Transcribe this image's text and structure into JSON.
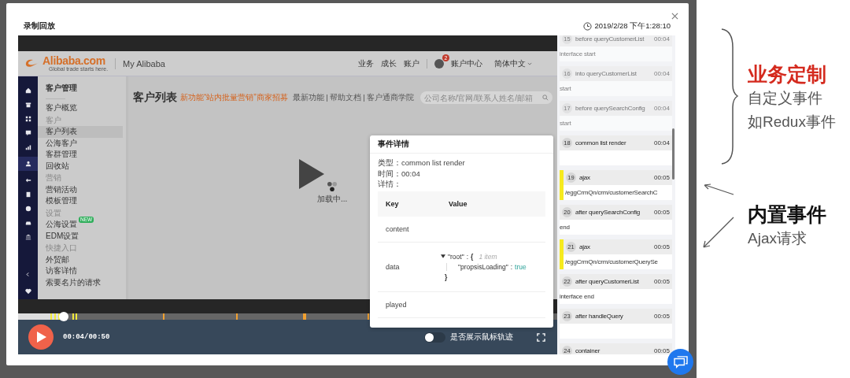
{
  "dialog": {
    "title": "录制回放",
    "timestamp": "2019/2/28 下午1:28:10"
  },
  "page": {
    "logo": "Alibaba.com",
    "logo_tagline": "Global trade starts here.",
    "site_name": "My Alibaba",
    "nav": [
      "业务",
      "成长",
      "账户"
    ],
    "notification_count": "2",
    "account": "账户中心",
    "language": "简体中文"
  },
  "sidebar": {
    "title": "客户管理",
    "items": [
      {
        "kind": "item",
        "label": "客户概览",
        "selected": false
      },
      {
        "kind": "group",
        "label": "客户"
      },
      {
        "kind": "item",
        "label": "客户列表",
        "selected": true
      },
      {
        "kind": "item",
        "label": "公海客户",
        "selected": false
      },
      {
        "kind": "item",
        "label": "客群管理",
        "selected": false
      },
      {
        "kind": "item",
        "label": "回收站",
        "selected": false
      },
      {
        "kind": "group",
        "label": "营销"
      },
      {
        "kind": "item",
        "label": "营销活动",
        "selected": false
      },
      {
        "kind": "item",
        "label": "模板管理",
        "selected": false
      },
      {
        "kind": "group",
        "label": "设置"
      },
      {
        "kind": "item",
        "label": "公海设置",
        "selected": false,
        "badge": "NEW"
      },
      {
        "kind": "item",
        "label": "EDM设置",
        "selected": false
      },
      {
        "kind": "group",
        "label": "快捷入口"
      },
      {
        "kind": "item",
        "label": "外贸邮",
        "selected": false
      },
      {
        "kind": "item",
        "label": "访客详情",
        "selected": false
      },
      {
        "kind": "item",
        "label": "索要名片的请求",
        "selected": false
      }
    ]
  },
  "main": {
    "heading": "客户列表",
    "promo": "新功能“站内批量营销”商家招募",
    "links": [
      "最新功能",
      "帮助文档",
      "客户通商学院"
    ],
    "search_placeholder": "公司名称/官网/联系人姓名/邮箱",
    "loading": "加载中..."
  },
  "player": {
    "progress": {
      "level": 0.085
    },
    "markers": [
      {
        "level": 0.06,
        "color": "#f2e93a"
      },
      {
        "level": 0.067,
        "color": "#f2e93a"
      },
      {
        "level": 0.074,
        "color": "#f2e93a"
      },
      {
        "level": 0.101,
        "color": "#f2e93a"
      },
      {
        "level": 0.107,
        "color": "#f2e93a"
      },
      {
        "level": 0.269,
        "color": "#f0a030"
      },
      {
        "level": 0.404,
        "color": "#f0a030"
      },
      {
        "level": 0.528,
        "color": "#f0a030"
      },
      {
        "level": 0.532,
        "color": "#f0a030"
      },
      {
        "level": 0.648,
        "color": "#f0a030"
      }
    ],
    "playing": false,
    "time": "00:04/00:50",
    "mouse_trail": {
      "label": "是否展示鼠标轨迹",
      "on": false
    }
  },
  "popup": {
    "title": "事件详情",
    "type_label": "类型：",
    "type": "common list render",
    "time_label": "时间：",
    "time": "00:04",
    "detail_label": "详情：",
    "columns": [
      "Key",
      "Value"
    ],
    "rows": [
      {
        "key": "content"
      },
      {
        "key": "data",
        "value": {
          "expanded": true,
          "root_key": "\"root\"",
          "colon": ":",
          "open": "{",
          "count": "1 item",
          "entries": [
            {
              "key": "\"propsisLoading\"",
              "colon": ":",
              "value": "true"
            }
          ],
          "close": "}"
        }
      },
      {
        "key": "played"
      }
    ]
  },
  "events": [
    {
      "kind": "custom",
      "number": "15",
      "name": "before queryCustomerList",
      "time": "00:04",
      "detail": "interface start",
      "faded": true
    },
    {
      "kind": "custom",
      "number": "16",
      "name": "into queryCustomerList",
      "time": "00:04",
      "detail": "start",
      "faded": true
    },
    {
      "kind": "custom",
      "number": "17",
      "name": "before querySearchConfig",
      "time": "00:04",
      "detail": "start",
      "faded": true
    },
    {
      "kind": "custom",
      "number": "18",
      "name": "common list render",
      "time": "00:04",
      "faded": false
    },
    {
      "kind": "ajax",
      "number": "19",
      "name": "ajax",
      "time": "00:05",
      "detail": "/eggCrmQn/crm/customerSearchC",
      "faded": false
    },
    {
      "kind": "custom",
      "number": "20",
      "name": "after querySearchConfig",
      "time": "00:05",
      "detail": "end",
      "faded": false
    },
    {
      "kind": "ajax",
      "number": "21",
      "name": "ajax",
      "time": "00:05",
      "detail": "/eggCrmQn/crm/customerQuerySe",
      "faded": false
    },
    {
      "kind": "custom",
      "number": "22",
      "name": "after queryCustomerList",
      "time": "00:05",
      "detail": "interface end",
      "faded": false
    },
    {
      "kind": "custom",
      "number": "23",
      "name": "after handleQuery",
      "time": "00:05",
      "faded": false
    },
    {
      "kind": "custom",
      "number": "24",
      "name": "container",
      "time": "00:05",
      "faded": false
    }
  ],
  "annotations": [
    {
      "title": "业务定制",
      "color": "#d42a1e",
      "notes": [
        "自定义事件",
        "如Redux事件"
      ]
    },
    {
      "title": "内置事件",
      "color": "#111111",
      "notes": [
        "Ajax请求"
      ]
    }
  ]
}
